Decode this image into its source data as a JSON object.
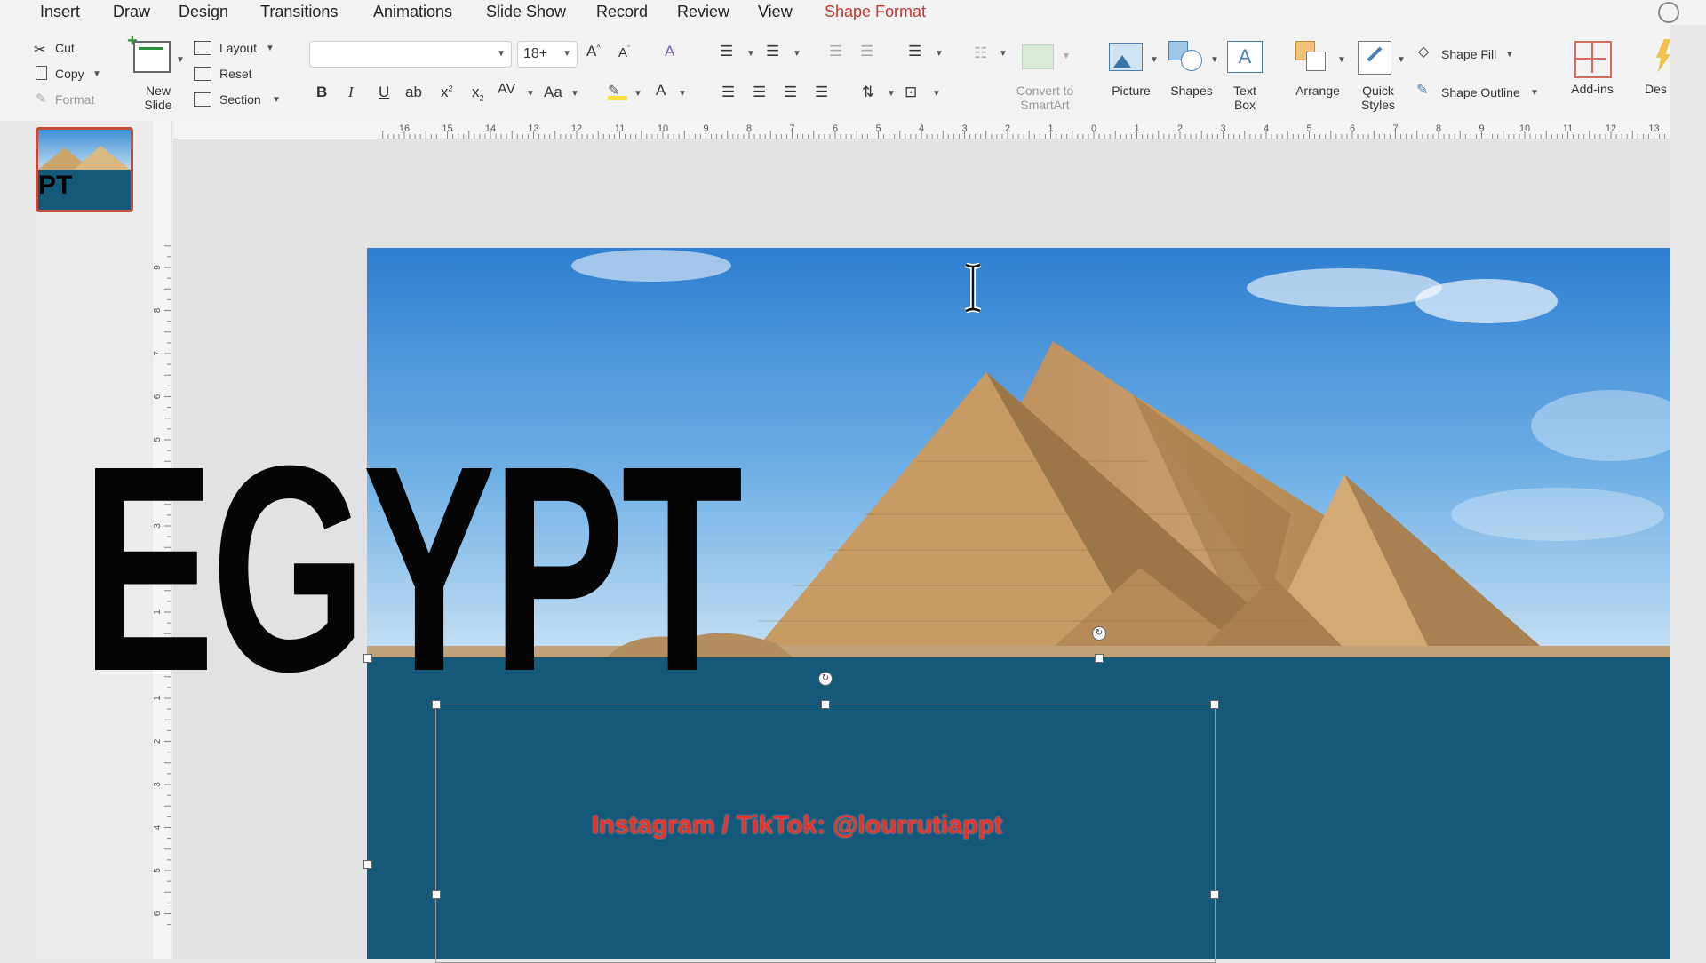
{
  "menu": {
    "items": [
      "Insert",
      "Draw",
      "Design",
      "Transitions",
      "Animations",
      "Slide Show",
      "Record",
      "Review",
      "View",
      "Shape Format"
    ],
    "active_index": 9
  },
  "clipboard": {
    "cut": "Cut",
    "copy": "Copy",
    "format": "Format"
  },
  "slides": {
    "new_slide": "New Slide",
    "layout": "Layout",
    "reset": "Reset",
    "section": "Section"
  },
  "font": {
    "name": "",
    "size": "18+"
  },
  "paragraph": {
    "convert_smartart": "Convert to SmartArt"
  },
  "insert": {
    "picture": "Picture",
    "shapes": "Shapes",
    "text_box": "Text Box",
    "arrange": "Arrange",
    "quick_styles": "Quick Styles",
    "shape_fill": "Shape Fill",
    "shape_outline": "Shape Outline",
    "addins": "Add-ins",
    "designer": "Des"
  },
  "thumbnail": {
    "text": "PT"
  },
  "ruler": {
    "h_ticks": [
      "16",
      "15",
      "14",
      "13",
      "12",
      "11",
      "10",
      "9",
      "8",
      "7",
      "6",
      "5",
      "4",
      "3",
      "2",
      "1",
      "0",
      "1",
      "2",
      "3",
      "4",
      "5",
      "6",
      "7",
      "8",
      "9",
      "10",
      "11",
      "12",
      "13"
    ],
    "v_ticks": [
      "9",
      "8",
      "7",
      "6",
      "5",
      "4",
      "3",
      "2",
      "1",
      "0",
      "1",
      "2",
      "3",
      "4",
      "5",
      "6"
    ]
  },
  "slide": {
    "title": "EGYPT",
    "watermark": "Instagram / TikTok: @lourrutiappt"
  },
  "colors": {
    "accent": "#c0392b",
    "slide_panel": "#14587a",
    "title": "#050505",
    "watermark": "#e5322b"
  }
}
